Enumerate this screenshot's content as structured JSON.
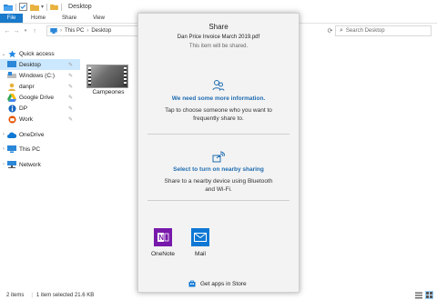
{
  "window": {
    "title": "Desktop"
  },
  "ribbon": {
    "tabs": [
      "File",
      "Home",
      "Share",
      "View"
    ]
  },
  "address": {
    "crumbs": [
      "This PC",
      "Desktop"
    ]
  },
  "search": {
    "placeholder": "Search Desktop"
  },
  "nav": {
    "items": [
      {
        "label": "Quick access"
      },
      {
        "label": "Desktop"
      },
      {
        "label": "Windows (C:)"
      },
      {
        "label": "danpr"
      },
      {
        "label": "Google Drive"
      },
      {
        "label": "DP"
      },
      {
        "label": "Work"
      },
      {
        "label": "OneDrive"
      },
      {
        "label": "This PC"
      },
      {
        "label": "Network"
      }
    ]
  },
  "content": {
    "file_name": "Campeones"
  },
  "status": {
    "count": "2 items",
    "selection": "1 item selected  21.6 KB"
  },
  "share": {
    "title": "Share",
    "file_name": "Dan Price Invoice March 2019.pdf",
    "note": "This item will be shared.",
    "contacts_heading": "We need some more information.",
    "contacts_body": "Tap to choose someone who you want to frequently share to.",
    "nearby_heading": "Select to turn on nearby sharing",
    "nearby_body": "Share to a nearby device using Bluetooth and Wi-Fi.",
    "apps": [
      {
        "label": "OneNote"
      },
      {
        "label": "Mail"
      }
    ],
    "store_link": "Get apps in Store"
  },
  "colors": {
    "accent": "#1979ca",
    "link": "#1f6cb0",
    "onenote": "#7719aa",
    "mail": "#0f78d4",
    "selection": "#cce8ff"
  }
}
